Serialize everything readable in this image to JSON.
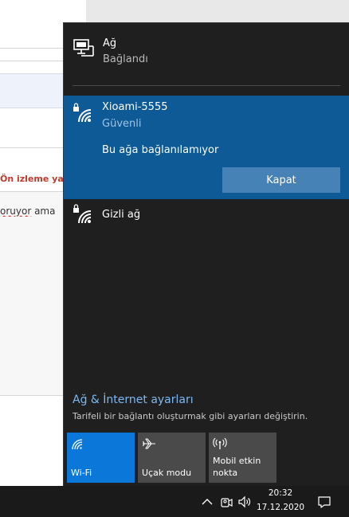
{
  "background": {
    "heading_fragment": "Ön izleme yap",
    "text_misspelled": "oruyor",
    "text_rest": " ama"
  },
  "flyout": {
    "header": {
      "title": "Ağ",
      "status": "Bağlandı",
      "icon": "network-computer-icon"
    },
    "selected_network": {
      "name": "Xioami-5555",
      "security": "Güvenli",
      "message": "Bu ağa bağlanılamıyor",
      "button_label": "Kapat",
      "icon": "wifi-secured-icon"
    },
    "hidden_network": {
      "name": "Gizli ağ",
      "icon": "wifi-secured-icon"
    },
    "settings": {
      "link": "Ağ & İnternet ayarları",
      "description": "Tarifeli bir bağlantı oluşturmak gibi ayarları değiştirin."
    },
    "quick_actions": [
      {
        "label": "Wi-Fi",
        "active": true,
        "icon": "wifi-icon"
      },
      {
        "label": "Uçak modu",
        "active": false,
        "icon": "airplane-icon"
      },
      {
        "label": "Mobil etkin nokta",
        "active": false,
        "icon": "hotspot-icon"
      }
    ]
  },
  "taskbar": {
    "time": "20:32",
    "date": "17.12.2020",
    "icons": [
      "chevron-up-icon",
      "meet-now-icon",
      "volume-icon",
      "action-center-icon"
    ]
  },
  "colors": {
    "flyout_bg": "#1f1f1f",
    "selected_bg": "#0e5a96",
    "button_bg": "#4682b6",
    "accent_tile": "#0b77d8",
    "link": "#7db8f0"
  }
}
